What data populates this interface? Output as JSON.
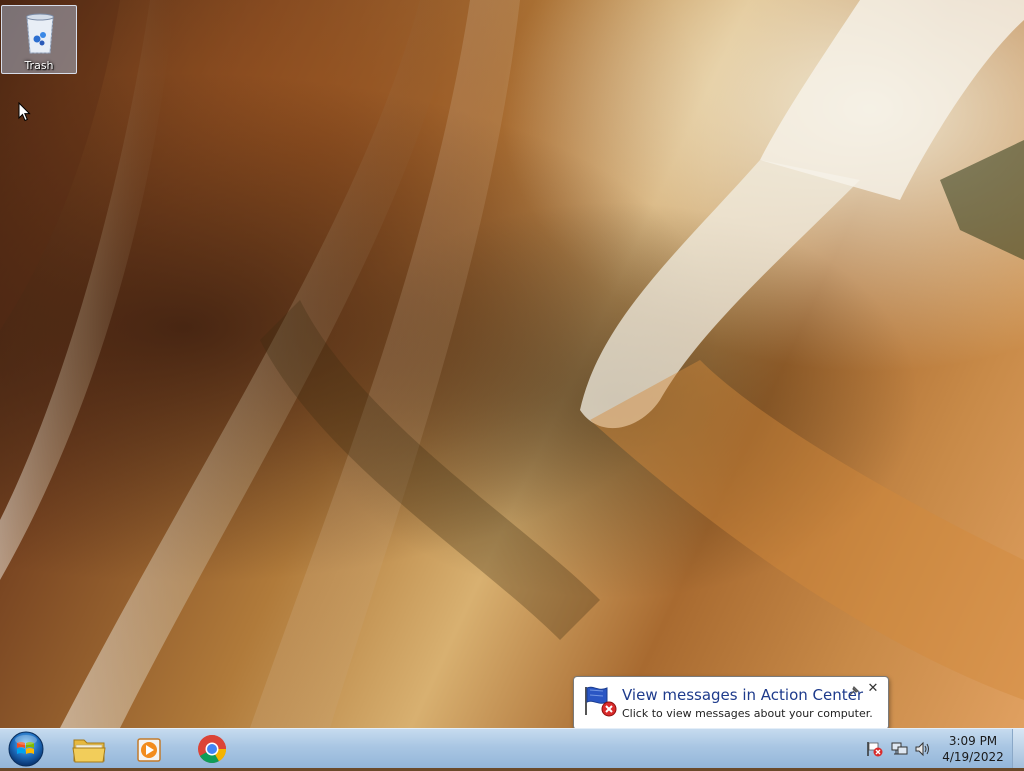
{
  "desktop": {
    "icons": [
      {
        "label": "Trash",
        "icon": "recycle-bin-icon"
      }
    ]
  },
  "notification": {
    "title": "View messages in Action Center",
    "text": "Click to view messages about your computer.",
    "icon": "action-center-flag-icon",
    "close_symbol": "✕"
  },
  "taskbar": {
    "start_icon": "windows-start-orb-icon",
    "pinned": [
      {
        "name": "Windows Explorer",
        "icon": "folder-icon"
      },
      {
        "name": "Windows Media Player",
        "icon": "media-player-icon"
      },
      {
        "name": "Google Chrome",
        "icon": "chrome-icon"
      }
    ],
    "tray_icons": [
      "action-center-flag-icon",
      "network-icon",
      "volume-icon"
    ],
    "clock": {
      "time": "3:09 PM",
      "date": "4/19/2022"
    }
  },
  "colors": {
    "taskbar_top": "#c6dbef",
    "taskbar_bottom": "#94b6d9",
    "balloon_title": "#1e3b8c"
  }
}
